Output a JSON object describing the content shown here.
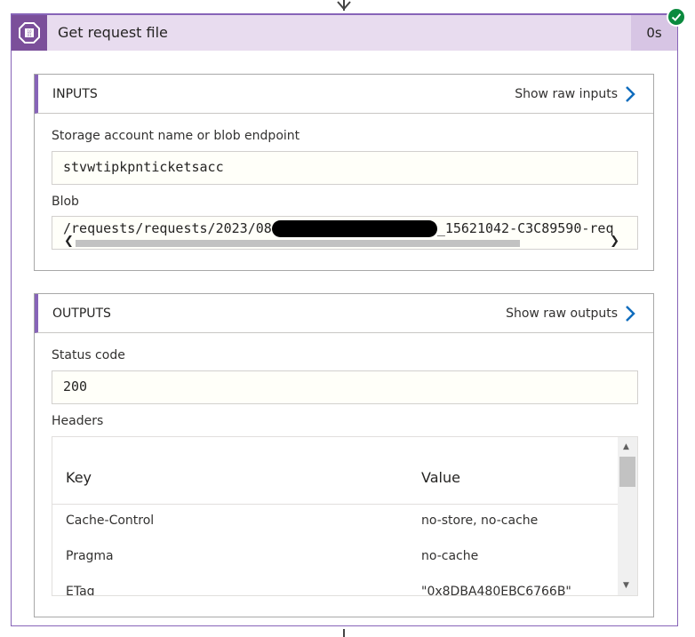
{
  "action": {
    "title": "Get request file",
    "duration": "0s",
    "icon": "blob-storage-icon",
    "status": "succeeded",
    "accent_color": "#8764b8",
    "success_color": "#0b8a3e"
  },
  "inputs": {
    "section_title": "INPUTS",
    "raw_link": "Show raw inputs",
    "storage_label": "Storage account name or blob endpoint",
    "storage_value": "stvwtipkpnticketsacc",
    "blob_label": "Blob",
    "blob_prefix": "/requests/requests/2023/08",
    "blob_suffix": "_15621042-C3C89590-req"
  },
  "outputs": {
    "section_title": "OUTPUTS",
    "raw_link": "Show raw outputs",
    "status_label": "Status code",
    "status_value": "200",
    "headers_label": "Headers",
    "headers": {
      "columns": [
        "Key",
        "Value"
      ],
      "rows": [
        {
          "key": "Cache-Control",
          "value": "no-store, no-cache"
        },
        {
          "key": "Pragma",
          "value": "no-cache"
        },
        {
          "key": "ETag",
          "value": "\"0x8DBA480EBC6766B\""
        }
      ]
    }
  }
}
